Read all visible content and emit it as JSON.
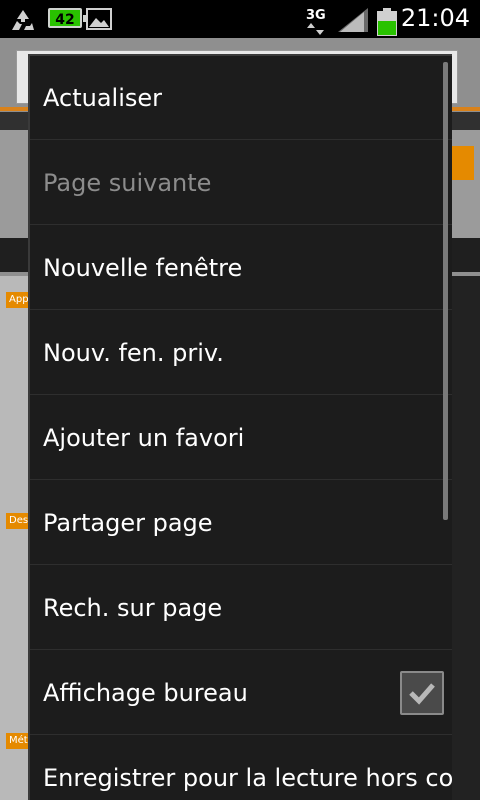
{
  "status_bar": {
    "battery_level_text": "42",
    "network_type": "3G",
    "time": "21:04"
  },
  "webpage": {
    "tag_1": "App",
    "tag_2": "Des",
    "tag_3": "Mét"
  },
  "menu": {
    "items": [
      {
        "label": "Actualiser"
      },
      {
        "label": "Page suivante"
      },
      {
        "label": "Nouvelle fenêtre"
      },
      {
        "label": "Nouv. fen. priv."
      },
      {
        "label": "Ajouter un favori"
      },
      {
        "label": "Partager page"
      },
      {
        "label": "Rech. sur page"
      },
      {
        "label": "Affichage bureau"
      },
      {
        "label": "Enregistrer pour la lecture hors co"
      }
    ],
    "desktop_view_checked": true
  }
}
